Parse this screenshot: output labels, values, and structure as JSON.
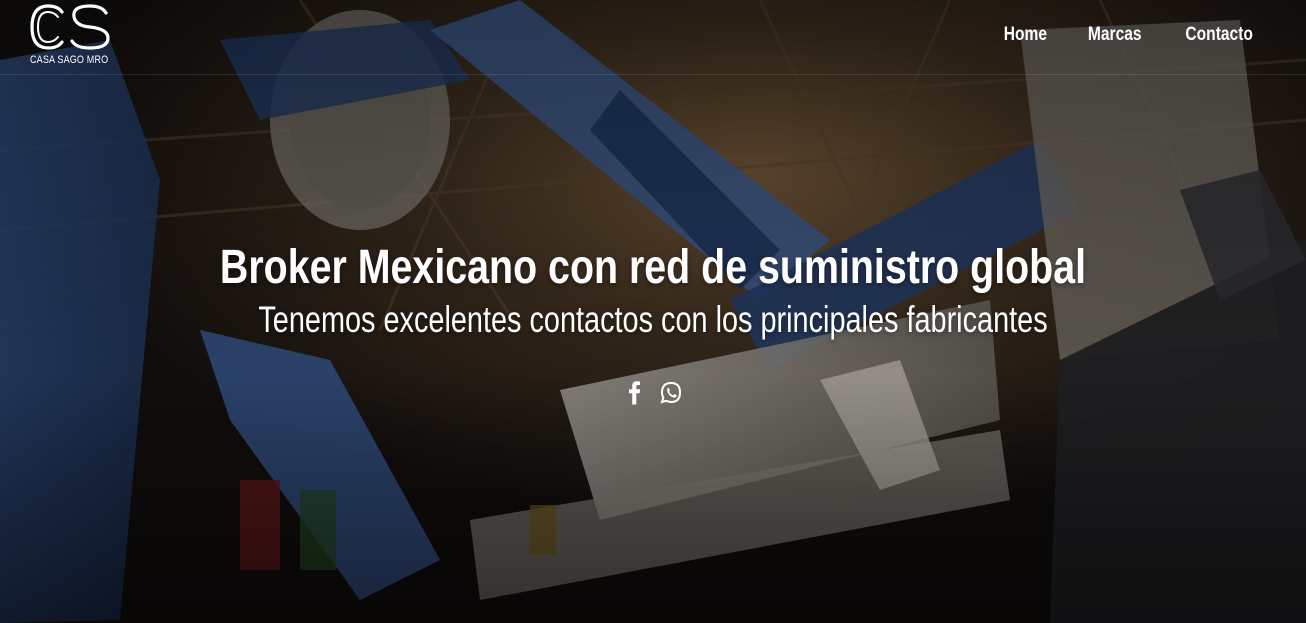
{
  "brand": {
    "logo_letters": "CS",
    "name": "CASA  SAGO MRO"
  },
  "nav": {
    "items": [
      {
        "label": "Home"
      },
      {
        "label": "Marcas"
      },
      {
        "label": "Contacto"
      }
    ]
  },
  "hero": {
    "title": "Broker Mexicano con red de suministro global",
    "subtitle": "Tenemos excelentes contactos con los principales fabricantes",
    "background": "industrial-robot-arms-photo"
  },
  "social": {
    "icons": [
      "facebook-icon",
      "whatsapp-icon"
    ]
  },
  "colors": {
    "text": "#ffffff",
    "robot_blue": "#2f4f8a",
    "warm_light": "#b8864a"
  }
}
